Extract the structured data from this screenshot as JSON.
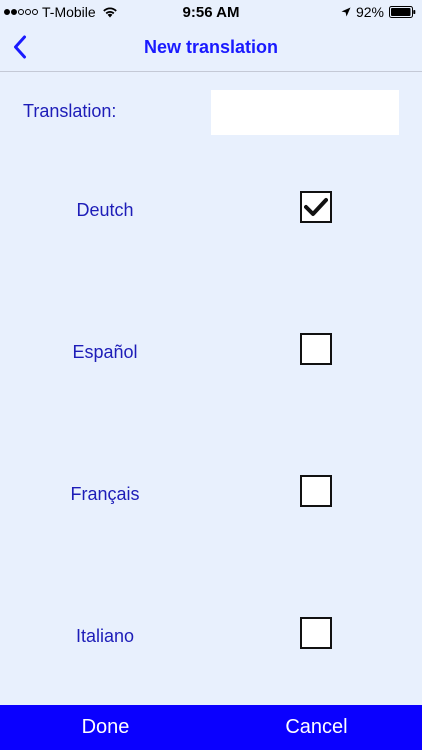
{
  "status_bar": {
    "carrier": "T-Mobile",
    "time": "9:56 AM",
    "battery": "92%",
    "signal_bars_filled": 2,
    "signal_bars_total": 5
  },
  "nav": {
    "title": "New translation",
    "back_icon": "chevron-left-icon"
  },
  "form": {
    "translation_label": "Translation:",
    "translation_value": "",
    "translation_placeholder": ""
  },
  "languages": [
    {
      "label": "Deutch",
      "checked": true
    },
    {
      "label": "Español",
      "checked": false
    },
    {
      "label": "Français",
      "checked": false
    },
    {
      "label": "Italiano",
      "checked": false
    }
  ],
  "bottom_bar": {
    "done_label": "Done",
    "cancel_label": "Cancel"
  },
  "colors": {
    "accent": "#1a1aff",
    "label_text": "#1d1db8",
    "background": "#e8f0fd",
    "bottom_bar": "#0a00ff"
  }
}
